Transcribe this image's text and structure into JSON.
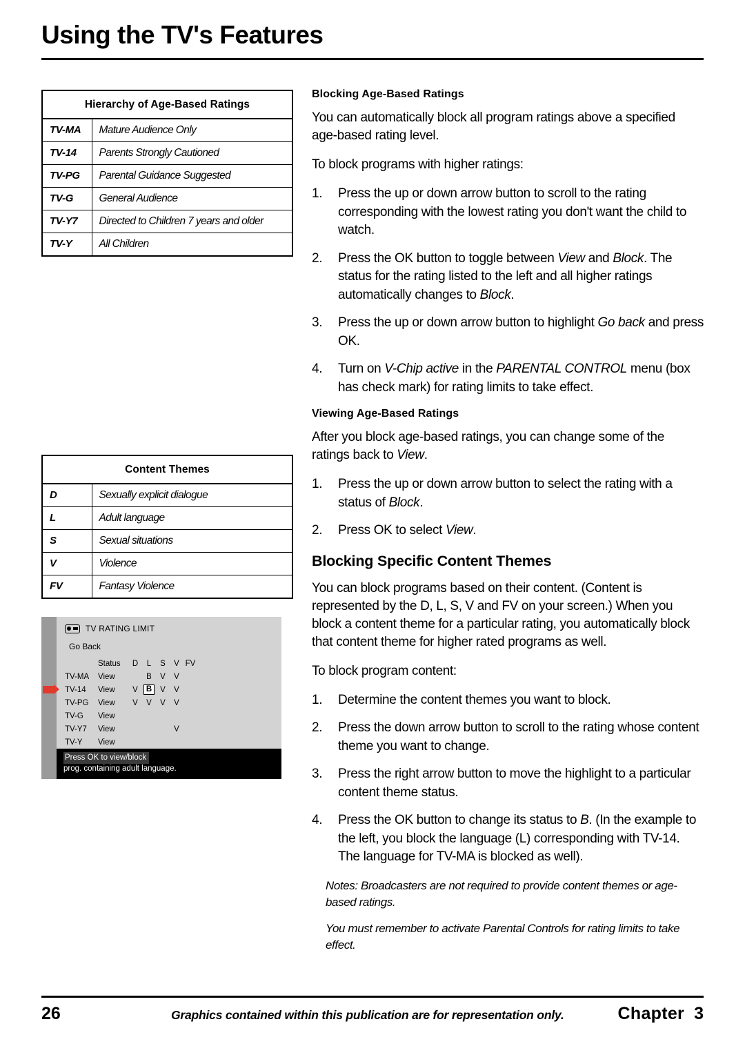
{
  "header": {
    "title": "Using the TV's Features"
  },
  "tables": {
    "age_based": {
      "title": "Hierarchy of Age-Based Ratings",
      "rows": [
        {
          "code": "TV-MA",
          "desc": "Mature Audience Only"
        },
        {
          "code": "TV-14",
          "desc": "Parents Strongly Cautioned"
        },
        {
          "code": "TV-PG",
          "desc": "Parental Guidance Suggested"
        },
        {
          "code": "TV-G",
          "desc": "General Audience"
        },
        {
          "code": "TV-Y7",
          "desc": "Directed to Children 7 years and older"
        },
        {
          "code": "TV-Y",
          "desc": "All Children"
        }
      ]
    },
    "content_themes": {
      "title": "Content Themes",
      "rows": [
        {
          "code": "D",
          "desc": "Sexually explicit dialogue"
        },
        {
          "code": "L",
          "desc": "Adult language"
        },
        {
          "code": "S",
          "desc": "Sexual situations"
        },
        {
          "code": "V",
          "desc": "Violence"
        },
        {
          "code": "FV",
          "desc": "Fantasy Violence"
        }
      ]
    }
  },
  "osd": {
    "icon": "tv-rating-icon",
    "title": "TV RATING LIMIT",
    "go_back": "Go Back",
    "columns": [
      "Status",
      "D",
      "L",
      "S",
      "V",
      "FV"
    ],
    "rows": [
      {
        "label": "TV-MA",
        "status": "View",
        "d": "",
        "l": "B",
        "s": "V",
        "v": "V",
        "fv": ""
      },
      {
        "label": "TV-14",
        "status": "View",
        "d": "V",
        "l": "B",
        "s": "V",
        "v": "V",
        "fv": "",
        "highlight": "l",
        "selected": true
      },
      {
        "label": "TV-PG",
        "status": "View",
        "d": "V",
        "l": "V",
        "s": "V",
        "v": "V",
        "fv": ""
      },
      {
        "label": "TV-G",
        "status": "View",
        "d": "",
        "l": "",
        "s": "",
        "v": "",
        "fv": ""
      },
      {
        "label": "TV-Y7",
        "status": "View",
        "d": "",
        "l": "",
        "s": "",
        "v": "V",
        "fv": ""
      },
      {
        "label": "TV-Y",
        "status": "View",
        "d": "",
        "l": "",
        "s": "",
        "v": "",
        "fv": ""
      }
    ],
    "footer_line1": "Press OK to view/block",
    "footer_line2": "prog. containing adult language.",
    "highlight_color": "#e23b2e"
  },
  "right": {
    "blocking_age": {
      "head": "Blocking Age-Based Ratings",
      "p1": "You can automatically block all program ratings above a specified age-based rating level.",
      "p2": "To block programs with higher ratings:",
      "steps": [
        {
          "num": "1.",
          "text_parts": [
            "Press the up or down arrow button to scroll to the rating corresponding with the lowest rating you don't want the child to watch."
          ]
        },
        {
          "num": "2.",
          "text_parts": [
            "Press the OK button to toggle between ",
            "View",
            " and ",
            "Block",
            ". The status for the rating listed to the left and all higher ratings automatically changes to ",
            "Block",
            "."
          ]
        },
        {
          "num": "3.",
          "text_parts": [
            "Press the up or down arrow button to highlight ",
            "Go back",
            " and press OK."
          ]
        },
        {
          "num": "4.",
          "text_parts": [
            "Turn on ",
            "V-Chip active",
            " in the ",
            "PARENTAL CONTROL",
            " menu (box has check mark) for rating limits to take effect."
          ]
        }
      ]
    },
    "viewing_age": {
      "head": "Viewing Age-Based Ratings",
      "p1_parts": [
        "After you block age-based ratings, you can change some of the ratings back to ",
        "View",
        "."
      ],
      "steps": [
        {
          "num": "1.",
          "text_parts": [
            "Press the up or down arrow button to select the rating with a status of ",
            "Block",
            "."
          ]
        },
        {
          "num": "2.",
          "text_parts": [
            "Press OK to select ",
            "View",
            "."
          ]
        }
      ]
    },
    "blocking_themes": {
      "head": "Blocking Specific Content Themes",
      "p1": "You can block programs based on their content. (Content is represented by the D, L, S, V and FV on your screen.) When you block a content theme for a particular rating, you automatically block that content theme for higher rated programs as well.",
      "p2": "To block program content:",
      "steps": [
        {
          "num": "1.",
          "text_parts": [
            "Determine the content themes you want to block."
          ]
        },
        {
          "num": "2.",
          "text_parts": [
            "Press the down arrow button to scroll to the rating whose content theme you want to change."
          ]
        },
        {
          "num": "3.",
          "text_parts": [
            "Press the right arrow button to move the highlight to a particular content theme status."
          ]
        },
        {
          "num": "4.",
          "text_parts": [
            "Press the OK button to change its status to ",
            "B",
            ". (In the example to the left, you block the language (L) corresponding with TV-14. The language for TV-MA is blocked as well)."
          ]
        }
      ],
      "note1": "Notes: Broadcasters are not required to provide content themes or age-based ratings.",
      "note2": "You must remember to activate Parental Controls for rating limits to take effect."
    }
  },
  "footer": {
    "page_number": "26",
    "note": "Graphics contained within this publication are for representation only.",
    "chapter_label": "Chapter",
    "chapter_number": "3"
  }
}
